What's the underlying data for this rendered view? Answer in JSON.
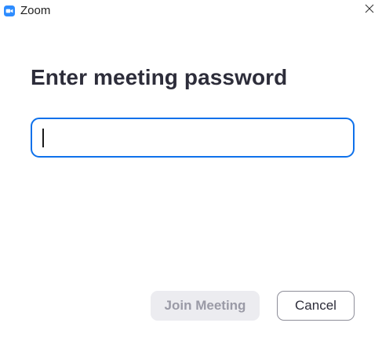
{
  "window": {
    "app_name": "Zoom",
    "app_icon": "zoom-camera-icon",
    "close_icon": "close-icon"
  },
  "dialog": {
    "heading": "Enter meeting password",
    "password_input": {
      "value": "",
      "placeholder": ""
    },
    "join_button_label": "Join Meeting",
    "join_button_enabled": false,
    "cancel_button_label": "Cancel"
  },
  "colors": {
    "accent": "#0e71eb",
    "heading_text": "#2d2d3a",
    "disabled_button_bg": "#ececf0",
    "disabled_button_text": "#9a9aa6"
  }
}
